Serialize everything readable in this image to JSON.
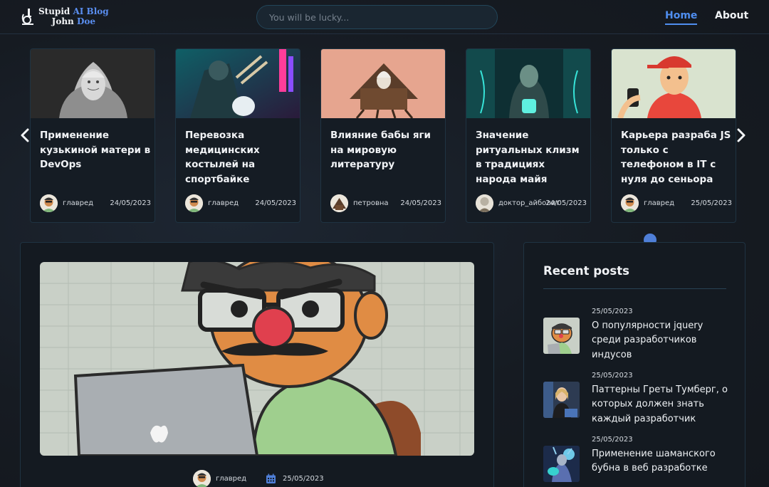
{
  "header": {
    "logo": {
      "line1_white": "Stupid ",
      "line1_blue": "AI Blog",
      "line2_white": "John ",
      "line2_blue": "Doe"
    },
    "search_placeholder": "You will be lucky...",
    "nav": {
      "home": "Home",
      "about": "About"
    }
  },
  "carousel": {
    "cards": [
      {
        "title": "Применение кузькиной матери в DevOps",
        "author": "главред",
        "date": "24/05/2023"
      },
      {
        "title": "Перевозка медицинских костылей на спортбайке",
        "author": "главред",
        "date": "24/05/2023"
      },
      {
        "title": "Влияние бабы яги на мировую литературу",
        "author": "петровна",
        "date": "24/05/2023"
      },
      {
        "title": "Значение ритуальных клизм в традициях народа майя",
        "author": "доктор_айболит",
        "date": "24/05/2023"
      },
      {
        "title": "Карьера разраба JS только с телефоном в IT с нуля до сеньора",
        "author": "главред",
        "date": "25/05/2023"
      }
    ]
  },
  "featured": {
    "author": "главред",
    "date": "25/05/2023"
  },
  "sidebar": {
    "title": "Recent posts",
    "posts": [
      {
        "date": "25/05/2023",
        "title": "О популярности jquery среди разработчиков индусов"
      },
      {
        "date": "25/05/2023",
        "title": "Паттерны Греты Тумберг, о которых должен знать каждый разработчик"
      },
      {
        "date": "25/05/2023",
        "title": "Применение шаманского бубна в веб разработке"
      }
    ]
  },
  "colors": {
    "accent": "#4f8ef0",
    "background": "#161b22",
    "panel": "#141a21",
    "border": "#1f3342"
  }
}
